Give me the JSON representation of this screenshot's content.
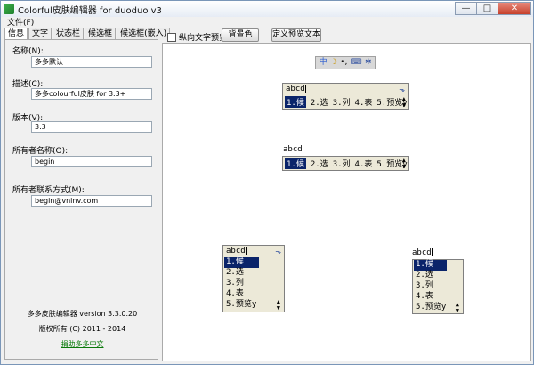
{
  "window": {
    "title": "Colorful皮肤编辑器 for duoduo v3",
    "buttons": {
      "minimize": "—",
      "maximize": "□",
      "close": "✕"
    }
  },
  "menu": {
    "file": "文件(F)"
  },
  "tabs": [
    "信息",
    "文字",
    "状态栏",
    "候选框",
    "候选框(嵌入)"
  ],
  "info": {
    "name_label": "名称(N):",
    "name_value": "多多默认",
    "desc_label": "描述(C):",
    "desc_value": "多多colourful皮肤 for 3.3+",
    "version_label": "版本(V):",
    "version_value": "3.3",
    "owner_label": "所有者名称(O):",
    "owner_value": "begin",
    "contact_label": "所有者联系方式(M):",
    "contact_value": "begin@vninv.com"
  },
  "about": {
    "version_text": "多多皮肤编辑器 version 3.3.0.20",
    "copyright_text": "版权所有 (C) 2011 - 2014",
    "sponsor_link": "捐助多多中文"
  },
  "toolbar": {
    "vertical_preview": "纵向文字预览",
    "background_btn": "背景色",
    "custom_text_btn": "定义预览文本"
  },
  "preview": {
    "composition": "abcd",
    "candidates": [
      "1.候",
      "2.选",
      "3.列",
      "4.表",
      "5.预览y"
    ],
    "arrow_up": "▲",
    "arrow_down": "▼",
    "pin_icon": "pin-icon",
    "status_icons": [
      "ime-icon",
      "moon-icon",
      "punct-icon",
      "keyboard-icon",
      "settings-icon"
    ],
    "status_glyphs": [
      "中",
      "☽",
      "•,",
      "⌨",
      "✲"
    ]
  },
  "colors": {
    "selection": "#0a246a",
    "panel_bg": "#ece9d8",
    "link": "#0a7a0a"
  }
}
